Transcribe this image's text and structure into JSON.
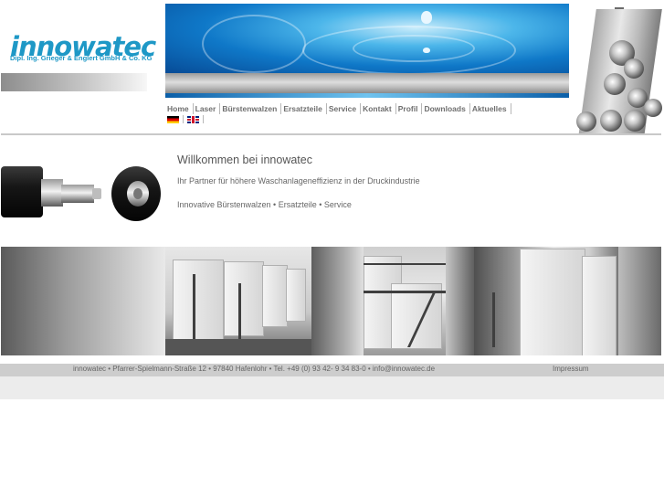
{
  "logo": {
    "name": "innowatec",
    "subtitle": "Dipl. Ing. Grieger & Englert GmbH & Co. KG"
  },
  "nav": {
    "items": [
      "Home",
      "Laser",
      "Bürstenwalzen",
      "Ersatzteile",
      "Service",
      "Kontakt",
      "Profil",
      "Downloads",
      "Aktuelles"
    ]
  },
  "languages": [
    "de-flag-icon",
    "uk-flag-icon"
  ],
  "content": {
    "welcome": "Willkommen bei innowatec",
    "partner": "Ihr Partner für höhere Waschanlageneffizienz in der Druckindustrie",
    "services": "Innovative Bürstenwalzen • Ersatzteile • Service"
  },
  "footer": {
    "contact": "innowatec  •  Pfarrer-Spielmann-Straße 12  •  97840 Hafenlohr  •  Tel. +49 (0) 93 42- 9 34 83-0  •  info@innowatec.de",
    "impressum": "Impressum"
  },
  "colors": {
    "brand": "#1e98c6",
    "nav_text": "#6f6f6f",
    "footer_bg": "#cdcdcd"
  }
}
